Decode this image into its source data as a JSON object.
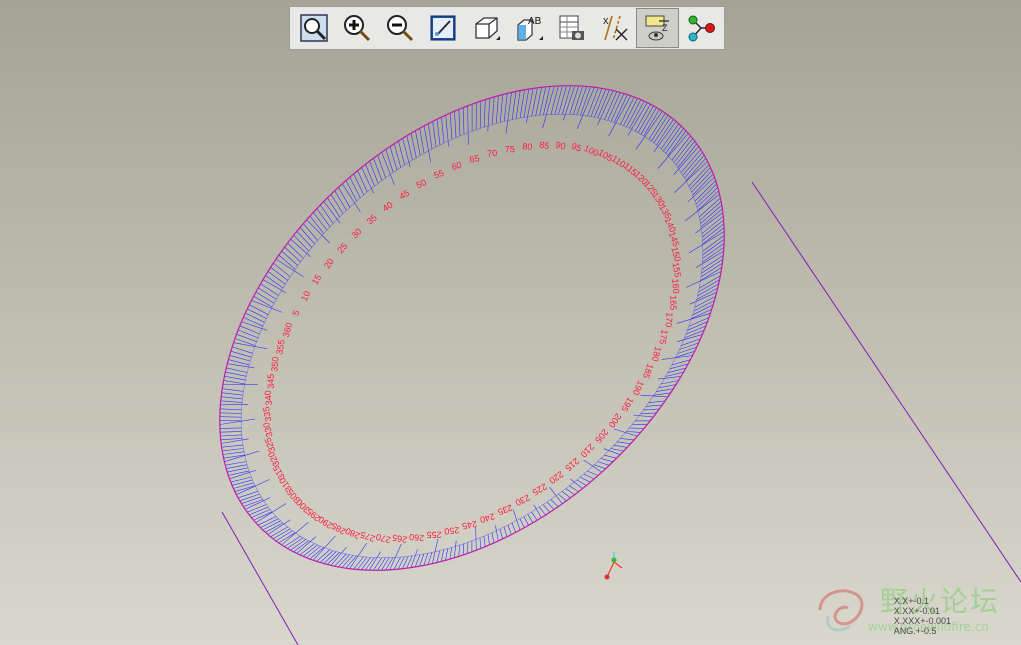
{
  "toolbar": {
    "buttons": [
      {
        "name": "refit-button",
        "icon": "zoom-fit-icon"
      },
      {
        "name": "zoom-in-button",
        "icon": "zoom-in-icon"
      },
      {
        "name": "zoom-out-button",
        "icon": "zoom-out-icon"
      },
      {
        "name": "repaint-button",
        "icon": "repaint-icon"
      },
      {
        "name": "display-style-button",
        "icon": "cube-shaded-icon"
      },
      {
        "name": "saved-views-button",
        "icon": "view-ab-icon"
      },
      {
        "name": "view-manager-button",
        "icon": "view-manager-icon"
      },
      {
        "name": "datum-display-button",
        "icon": "datum-filter-icon"
      },
      {
        "name": "spin-center-button",
        "icon": "spin-center-icon",
        "active": true
      },
      {
        "name": "orient-mode-button",
        "icon": "orient-mode-icon"
      }
    ]
  },
  "dial": {
    "angle_labels": [
      "5",
      "10",
      "15",
      "20",
      "25",
      "30",
      "35",
      "40",
      "45",
      "50",
      "55",
      "60",
      "65",
      "70",
      "75",
      "80",
      "85",
      "90",
      "95",
      "100",
      "105",
      "110",
      "115",
      "120",
      "125",
      "130",
      "135",
      "140",
      "145",
      "150",
      "155",
      "160",
      "165",
      "170",
      "175",
      "180",
      "185",
      "190",
      "195",
      "200",
      "205",
      "210",
      "215",
      "220",
      "225",
      "230",
      "235",
      "240",
      "245",
      "250",
      "255",
      "260",
      "265",
      "270",
      "275",
      "280",
      "285",
      "290",
      "295",
      "300",
      "305",
      "310",
      "315",
      "320",
      "325",
      "330",
      "335",
      "340",
      "345",
      "350",
      "355",
      "360"
    ]
  },
  "tolerances": {
    "line1": "X.X+-0.1",
    "line2": "X.XX+-0.01",
    "line3": "X.XXX+-0.001",
    "line4": "ANG.+-0.5"
  },
  "watermark": {
    "text": "野火论坛",
    "url": "www.proewildfire.cn"
  },
  "colors": {
    "tick_blue": "#3030ff",
    "label_red": "#ff1a40",
    "edge_magenta": "#c01ab0",
    "cylinder_line": "#8a1ab8"
  }
}
